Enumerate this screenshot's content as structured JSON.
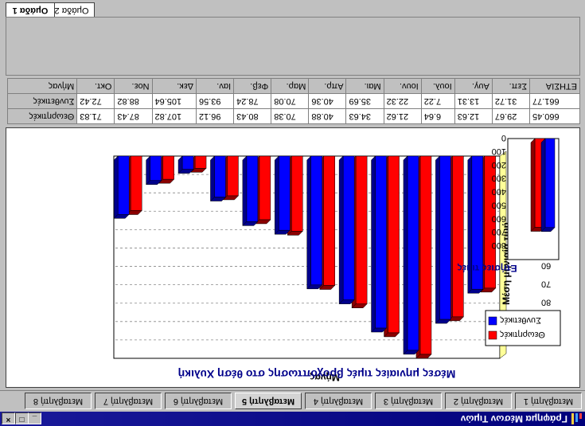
{
  "window": {
    "title": "Γράφημα Μέσων Τιμών",
    "btn_min": "_",
    "btn_max": "□",
    "btn_close": "×"
  },
  "variable_tabs": [
    {
      "label": "Μεταβλητή 1",
      "active": false
    },
    {
      "label": "Μεταβλητή 2",
      "active": false
    },
    {
      "label": "Μεταβλητή 3",
      "active": false
    },
    {
      "label": "Μεταβλητή 4",
      "active": false
    },
    {
      "label": "Μεταβλητή 5",
      "active": true
    },
    {
      "label": "Μεταβλητή 6",
      "active": false
    },
    {
      "label": "Μεταβλητή 7",
      "active": false
    },
    {
      "label": "Μεταβλητή 8",
      "active": false
    }
  ],
  "group_tabs": [
    {
      "label": "Ομάδα 1",
      "active": true
    },
    {
      "label": "Ομάδα 2",
      "active": false
    }
  ],
  "colors": {
    "series1": "#ff0000",
    "series2": "#0000ff",
    "title": "#00008b",
    "wall": "#ffff99"
  },
  "chart_data": [
    {
      "type": "bar",
      "title": "Μέσες μηνιαίες τιμές βροχόπτωσης στο θέση Χυλική",
      "xlabel": "Μήνας",
      "ylabel": "Μέση μηνιαία τιμή",
      "ylim": [
        0,
        110
      ],
      "yticks": [
        "0",
        "10",
        "20",
        "30",
        "40",
        "50",
        "60",
        "70",
        "80",
        "90",
        "100"
      ],
      "categories": [
        "Οκτ.",
        "Νοε.",
        "Δεκ.",
        "Ιαν.",
        "Φεβ.",
        "Μαρ.",
        "Απρ.",
        "Μαι.",
        "Ιουν.",
        "Ιουλ.",
        "Αυγ.",
        "Σεπ."
      ],
      "series": [
        {
          "name": "Θεωρητικές",
          "values": [
            71.83,
            87.43,
            107.82,
            96.12,
            80.43,
            70.38,
            40.88,
            34.63,
            21.62,
            6.64,
            12.63,
            29.67
          ]
        },
        {
          "name": "Συνθετικές",
          "values": [
            72.42,
            88.82,
            105.64,
            93.56,
            78.24,
            70.08,
            40.36,
            35.69,
            22.32,
            7.22,
            13.31,
            31.72
          ]
        }
      ],
      "legend": "bottom-right",
      "grid": true
    },
    {
      "type": "bar",
      "title": "",
      "xlabel": "Ετήσιες τιμές",
      "ylabel": "",
      "ylim": [
        0,
        900
      ],
      "yticks": [
        "0",
        "100",
        "200",
        "300",
        "400",
        "500",
        "600",
        "700",
        "800"
      ],
      "categories": [
        ""
      ],
      "series": [
        {
          "name": "Θεωρητικές",
          "values": [
            660.45
          ]
        },
        {
          "name": "Συνθετικές",
          "values": [
            661.77
          ]
        }
      ]
    }
  ],
  "table": {
    "header_label": "Μήνας",
    "total_label": "ΕΤΗΣΙΑ",
    "rows": [
      {
        "label": "Θεωρητικές",
        "values": [
          "71.83",
          "87.43",
          "107.82",
          "96.12",
          "80.43",
          "70.38",
          "40.88",
          "34.63",
          "21.62",
          "6.64",
          "12.63",
          "29.67",
          "660.45"
        ]
      },
      {
        "label": "Συνθετικές",
        "values": [
          "72.42",
          "88.82",
          "105.64",
          "93.56",
          "78.24",
          "70.08",
          "40.36",
          "35.69",
          "22.32",
          "7.22",
          "13.31",
          "31.72",
          "661.77"
        ]
      }
    ]
  }
}
